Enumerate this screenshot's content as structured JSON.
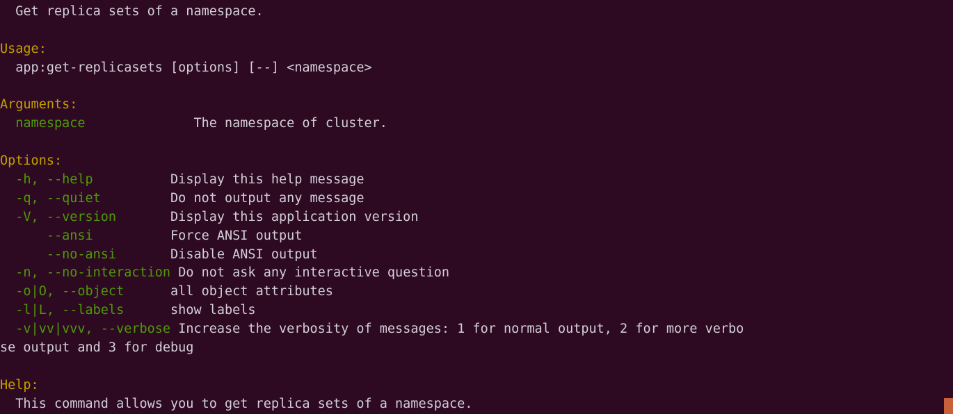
{
  "terminal": {
    "background_color": "#2d0a22",
    "text_color": "#d3cfd8",
    "header_color": "#c4a000",
    "flag_color": "#4e9a06",
    "cursor_color": "#c8603c",
    "columns": 110,
    "description_column": 27
  },
  "output": {
    "summary": "  Get replica sets of a namespace.",
    "usage_header": "Usage:",
    "usage_line": "  app:get-replicasets [options] [--] <namespace>",
    "arguments_header": "Arguments:",
    "arguments": [
      {
        "name": "  namespace",
        "pad": "              ",
        "description": "The namespace of cluster."
      }
    ],
    "options_header": "Options:",
    "options": [
      {
        "flags": "  -h, --help",
        "pad": "          ",
        "description": "Display this help message"
      },
      {
        "flags": "  -q, --quiet",
        "pad": "         ",
        "description": "Do not output any message"
      },
      {
        "flags": "  -V, --version",
        "pad": "       ",
        "description": "Display this application version"
      },
      {
        "flags": "      --ansi",
        "pad": "          ",
        "description": "Force ANSI output"
      },
      {
        "flags": "      --no-ansi",
        "pad": "       ",
        "description": "Disable ANSI output"
      },
      {
        "flags": "  -n, --no-interaction",
        "pad": " ",
        "description": "Do not ask any interactive question"
      },
      {
        "flags": "  -o|O, --object",
        "pad": "      ",
        "description": "all object attributes"
      },
      {
        "flags": "  -l|L, --labels",
        "pad": "      ",
        "description": "show labels"
      },
      {
        "flags": "  -v|vv|vvv, --verbose",
        "pad": " ",
        "description": "Increase the verbosity of messages: 1 for normal output, 2 for more verbo"
      }
    ],
    "options_wrap_line": "se output and 3 for debug",
    "help_header": "Help:",
    "help_body": "  This command allows you to get replica sets of a namespace."
  }
}
